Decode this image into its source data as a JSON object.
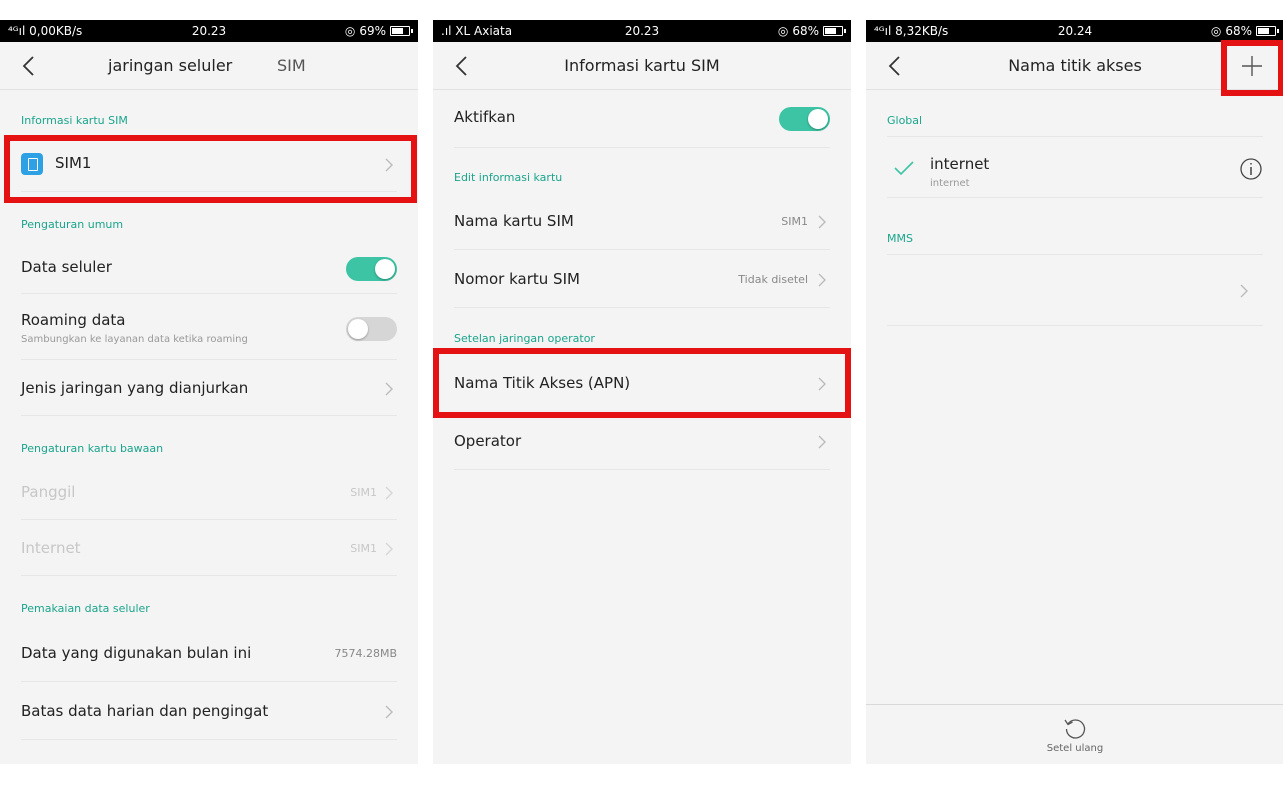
{
  "screen1": {
    "status": {
      "left": "⁴ᴳıl 0,00KB/s",
      "time": "20.23",
      "battery": "69%"
    },
    "title_left": "jaringan seluler",
    "title_right": "SIM",
    "sec_sim_info": "Informasi kartu SIM",
    "sim1_label": "SIM1",
    "sec_general": "Pengaturan umum",
    "data_seluler": {
      "label": "Data seluler",
      "on": true
    },
    "roaming": {
      "label": "Roaming data",
      "sub": "Sambungkan ke layanan data ketika roaming",
      "on": false
    },
    "network_pref": "Jenis jaringan yang dianjurkan",
    "sec_default": "Pengaturan kartu bawaan",
    "panggil": {
      "label": "Panggil",
      "value": "SIM1"
    },
    "internet": {
      "label": "Internet",
      "value": "SIM1"
    },
    "sec_usage": "Pemakaian data seluler",
    "usage_month": {
      "label": "Data yang digunakan bulan ini",
      "value": "7574.28MB"
    },
    "limit": "Batas data harian dan pengingat"
  },
  "screen2": {
    "status": {
      "left": ".ıl XL Axiata",
      "time": "20.23",
      "battery": "68%"
    },
    "title": "Informasi kartu SIM",
    "aktifkan": {
      "label": "Aktifkan",
      "on": true
    },
    "sec_edit": "Edit informasi kartu",
    "sim_name": {
      "label": "Nama kartu SIM",
      "value": "SIM1"
    },
    "sim_number": {
      "label": "Nomor kartu SIM",
      "value": "Tidak disetel"
    },
    "sec_operator": "Setelan jaringan operator",
    "apn": "Nama Titik Akses (APN)",
    "operator": "Operator"
  },
  "screen3": {
    "status": {
      "left": "⁴ᴳıl 8,32KB/s",
      "time": "20.24",
      "battery": "68%"
    },
    "title": "Nama titik akses",
    "sec_global": "Global",
    "apn_item": {
      "name": "internet",
      "sub": "internet"
    },
    "sec_mms": "MMS",
    "reset_label": "Setel ulang"
  },
  "colors": {
    "accent": "#1aa58c",
    "toggle_on": "#3cc4a4",
    "highlight": "#e41212",
    "sim_icon": "#2da1e4"
  },
  "icons": [
    "back-icon",
    "chevron-right-icon",
    "sim-card-icon",
    "check-icon",
    "info-icon",
    "plus-icon",
    "reset-icon",
    "eye-icon",
    "alarm-off-icon",
    "battery-icon"
  ]
}
